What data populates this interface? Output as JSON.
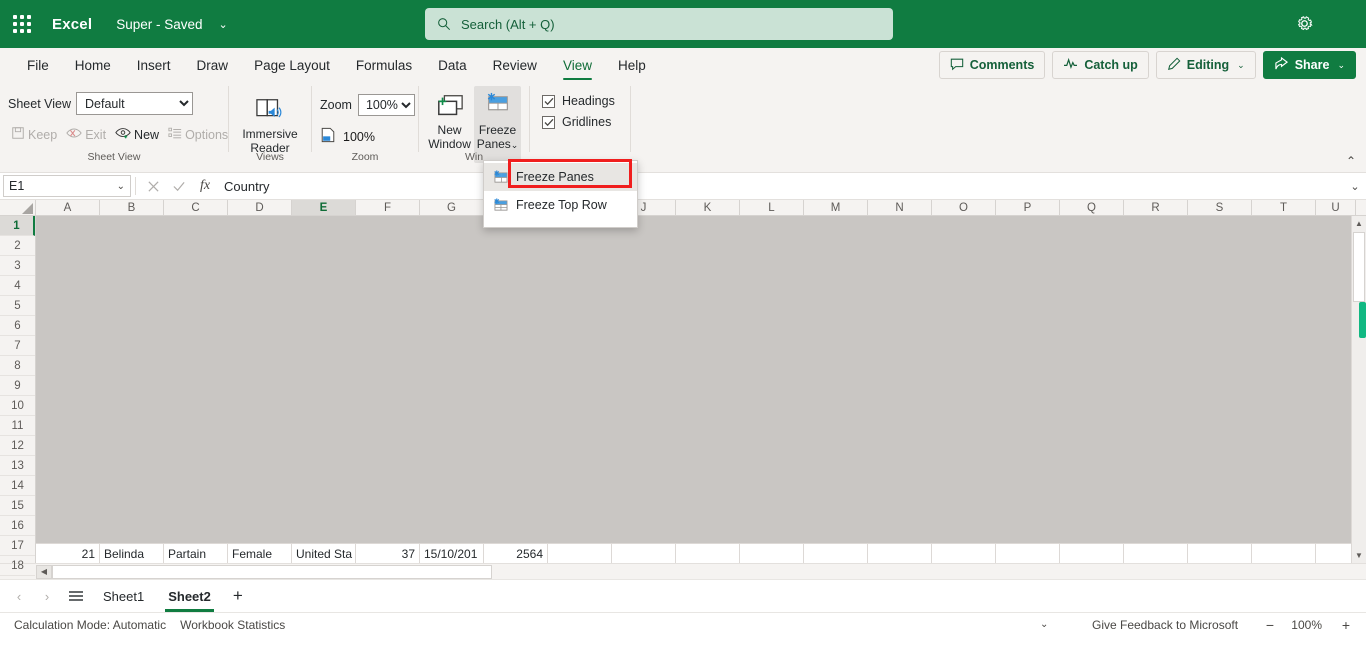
{
  "titlebar": {
    "app_name": "Excel",
    "doc_title": "Super  -  Saved",
    "doc_chevron": "⌄",
    "waffle_icon": "app-launcher-icon",
    "gear_icon": "settings-gear-icon",
    "search": {
      "placeholder": "Search (Alt + Q)",
      "icon": "search-icon"
    }
  },
  "tabs": [
    {
      "label": "File",
      "active": false
    },
    {
      "label": "Home",
      "active": false
    },
    {
      "label": "Insert",
      "active": false
    },
    {
      "label": "Draw",
      "active": false
    },
    {
      "label": "Page Layout",
      "active": false
    },
    {
      "label": "Formulas",
      "active": false
    },
    {
      "label": "Data",
      "active": false
    },
    {
      "label": "Review",
      "active": false
    },
    {
      "label": "View",
      "active": true
    },
    {
      "label": "Help",
      "active": false
    }
  ],
  "ribbon_actions": {
    "comments": "Comments",
    "catch_up": "Catch up",
    "editing": "Editing",
    "editing_chevron": "⌄",
    "share": "Share",
    "share_chevron": "⌄"
  },
  "ribbon": {
    "sheet_view": {
      "group_label": "Sheet View",
      "label": "Sheet View",
      "selected": "Default",
      "options": [
        "Default"
      ],
      "keep": "Keep",
      "exit": "Exit",
      "new": "New",
      "options_btn": "Options"
    },
    "views": {
      "group_label": "Views",
      "immersive_reader_line1": "Immersive",
      "immersive_reader_line2": "Reader"
    },
    "zoom": {
      "group_label": "Zoom",
      "label": "Zoom",
      "selected": "100%",
      "options": [
        "100%"
      ],
      "zoom_100": "100%"
    },
    "window": {
      "group_label": "Win",
      "new_window_line1": "New",
      "new_window_line2": "Window",
      "freeze_panes_line1": "Freeze",
      "freeze_panes_line2": "Panes",
      "freeze_chevron": "⌄"
    },
    "show": {
      "headings": "Headings",
      "headings_checked": true,
      "gridlines": "Gridlines",
      "gridlines_checked": true
    },
    "collapse_chevron": "⌃"
  },
  "freeze_menu": {
    "items": [
      {
        "label": "Freeze Panes",
        "icon": "freeze-panes-icon",
        "highlighted": true
      },
      {
        "label": "Freeze Top Row",
        "icon": "freeze-top-row-icon",
        "highlighted": false
      }
    ]
  },
  "formula_bar": {
    "name_box": "E1",
    "name_chevron": "⌄",
    "cancel_icon": "cancel-x-icon",
    "enter_icon": "enter-check-icon",
    "fx_icon": "fx-icon",
    "value": "Country",
    "collapse_chevron": "⌄"
  },
  "grid": {
    "columns": [
      "A",
      "B",
      "C",
      "D",
      "E",
      "F",
      "G",
      "H",
      "I",
      "J",
      "K",
      "L",
      "M",
      "N",
      "O",
      "P",
      "Q",
      "R",
      "S",
      "T",
      "U"
    ],
    "selected_column": "E",
    "rows": [
      "1",
      "2",
      "3",
      "4",
      "5",
      "6",
      "7",
      "8",
      "9",
      "10",
      "11",
      "12",
      "13",
      "14",
      "15",
      "16",
      "17",
      "18"
    ],
    "selected_row": "1",
    "partial_row": [
      "21",
      "Belinda",
      "Partain",
      "Female",
      "United Sta",
      "37",
      "15/10/201",
      "2564"
    ],
    "scroll_up_icon": "▲",
    "scroll_down_icon": "▼",
    "scroll_left_icon": "◀"
  },
  "sheet_tabs": {
    "prev_icon": "‹",
    "next_icon": "›",
    "menu_icon": "all-sheets-icon",
    "tabs": [
      {
        "label": "Sheet1",
        "active": false
      },
      {
        "label": "Sheet2",
        "active": true
      }
    ],
    "add_icon": "+"
  },
  "status_bar": {
    "calculation_mode": "Calculation Mode: Automatic",
    "workbook_statistics": "Workbook Statistics",
    "chevron": "⌄",
    "feedback": "Give Feedback to Microsoft",
    "zoom_out": "−",
    "zoom_value": "100%",
    "zoom_in": "+"
  },
  "colors": {
    "brand_green": "#107c41",
    "accent_text": "#15603a",
    "highlight_red": "#f01e1e",
    "scroll_marker": "#11b882"
  }
}
